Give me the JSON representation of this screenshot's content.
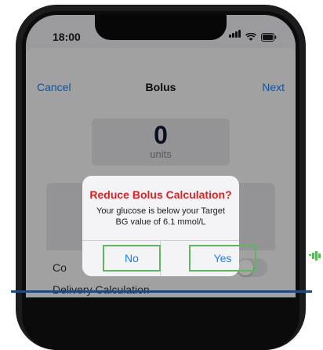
{
  "status_bar": {
    "time": "18:00",
    "icons": [
      "signal-icon",
      "wifi-icon",
      "battery-icon"
    ]
  },
  "nav": {
    "cancel": "Cancel",
    "title": "Bolus",
    "next": "Next"
  },
  "bolus": {
    "value": "0",
    "unit": "units"
  },
  "rows": {
    "correction_label": "Co",
    "delivery_label": "Delivery Calculation"
  },
  "alert": {
    "title": "Reduce Bolus Calculation?",
    "message": "Your glucose is below your Target BG value of 6.1 mmol/L",
    "no": "No",
    "yes": "Yes"
  },
  "colors": {
    "accent_blue": "#147efb",
    "alert_red": "#e02020",
    "highlight_green": "#5cb85c",
    "rule_navy": "#1f4a7a"
  }
}
